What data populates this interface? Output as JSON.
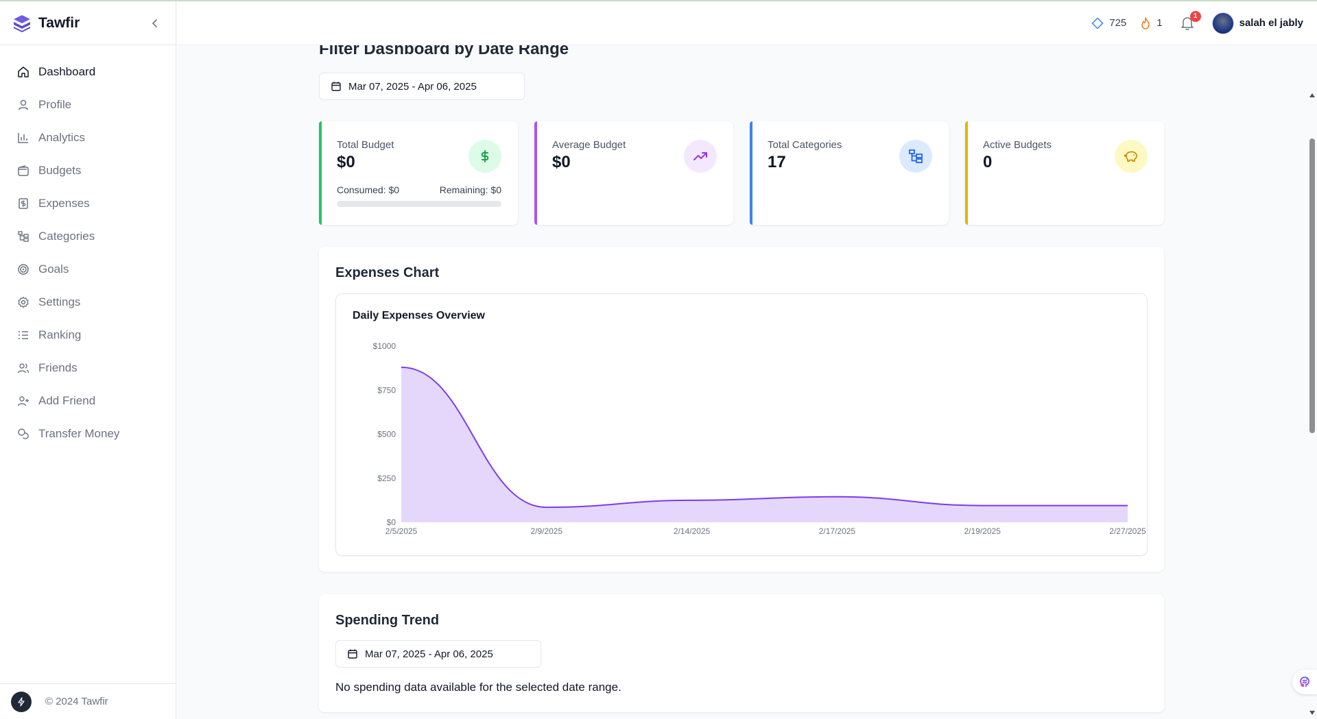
{
  "app": {
    "name": "Tawfir",
    "copyright": "© 2024 Tawfir"
  },
  "sidebar": {
    "items": [
      {
        "label": "Dashboard",
        "icon": "home-icon",
        "active": true
      },
      {
        "label": "Profile",
        "icon": "user-icon"
      },
      {
        "label": "Analytics",
        "icon": "bar-chart-icon"
      },
      {
        "label": "Budgets",
        "icon": "wallet-icon"
      },
      {
        "label": "Expenses",
        "icon": "dollar-receipt-icon"
      },
      {
        "label": "Categories",
        "icon": "folder-tree-icon"
      },
      {
        "label": "Goals",
        "icon": "target-icon"
      },
      {
        "label": "Settings",
        "icon": "gear-icon"
      },
      {
        "label": "Ranking",
        "icon": "list-ordered-icon"
      },
      {
        "label": "Friends",
        "icon": "users-icon"
      },
      {
        "label": "Add Friend",
        "icon": "user-plus-icon"
      },
      {
        "label": "Transfer Money",
        "icon": "coins-icon"
      }
    ]
  },
  "header": {
    "points": "725",
    "streak": "1",
    "notifications": "1",
    "username": "salah el jably"
  },
  "main": {
    "title": "Filter Dashboard by Date Range",
    "date_range": "Mar 07, 2025 - Apr 06, 2025"
  },
  "stats": [
    {
      "label": "Total Budget",
      "value": "$0",
      "accent": "#22c55e",
      "icon": "dollar-icon",
      "icon_bg": "#dcfce7",
      "icon_color": "#16a34a",
      "consumed": "Consumed: $0",
      "remaining": "Remaining: $0",
      "progress": 0
    },
    {
      "label": "Average Budget",
      "value": "$0",
      "accent": "#a855f7",
      "icon": "trending-up-icon",
      "icon_bg": "#f3e8ff",
      "icon_color": "#9333ea"
    },
    {
      "label": "Total Categories",
      "value": "17",
      "accent": "#3b82f6",
      "icon": "folder-tree-icon",
      "icon_bg": "#dbeafe",
      "icon_color": "#2563eb"
    },
    {
      "label": "Active Budgets",
      "value": "0",
      "accent": "#eab308",
      "icon": "piggy-bank-icon",
      "icon_bg": "#fef9c3",
      "icon_color": "#ca8a04"
    }
  ],
  "expenses_panel": {
    "title": "Expenses Chart"
  },
  "chart_data": {
    "type": "area",
    "title": "Daily Expenses Overview",
    "x": [
      "2/5/2025",
      "2/9/2025",
      "2/14/2025",
      "2/17/2025",
      "2/19/2025",
      "2/27/2025"
    ],
    "series": [
      {
        "values": [
          880,
          85,
          125,
          145,
          95,
          95
        ]
      }
    ],
    "yticks": [
      "$0",
      "$250",
      "$500",
      "$750",
      "$1000"
    ],
    "ylim": [
      0,
      1000
    ],
    "color": "#7c3aed",
    "fill": "#e4d7fb"
  },
  "spending_panel": {
    "title": "Spending Trend",
    "date_range": "Mar 07, 2025 - Apr 06, 2025",
    "empty_message": "No spending data available for the selected date range."
  }
}
